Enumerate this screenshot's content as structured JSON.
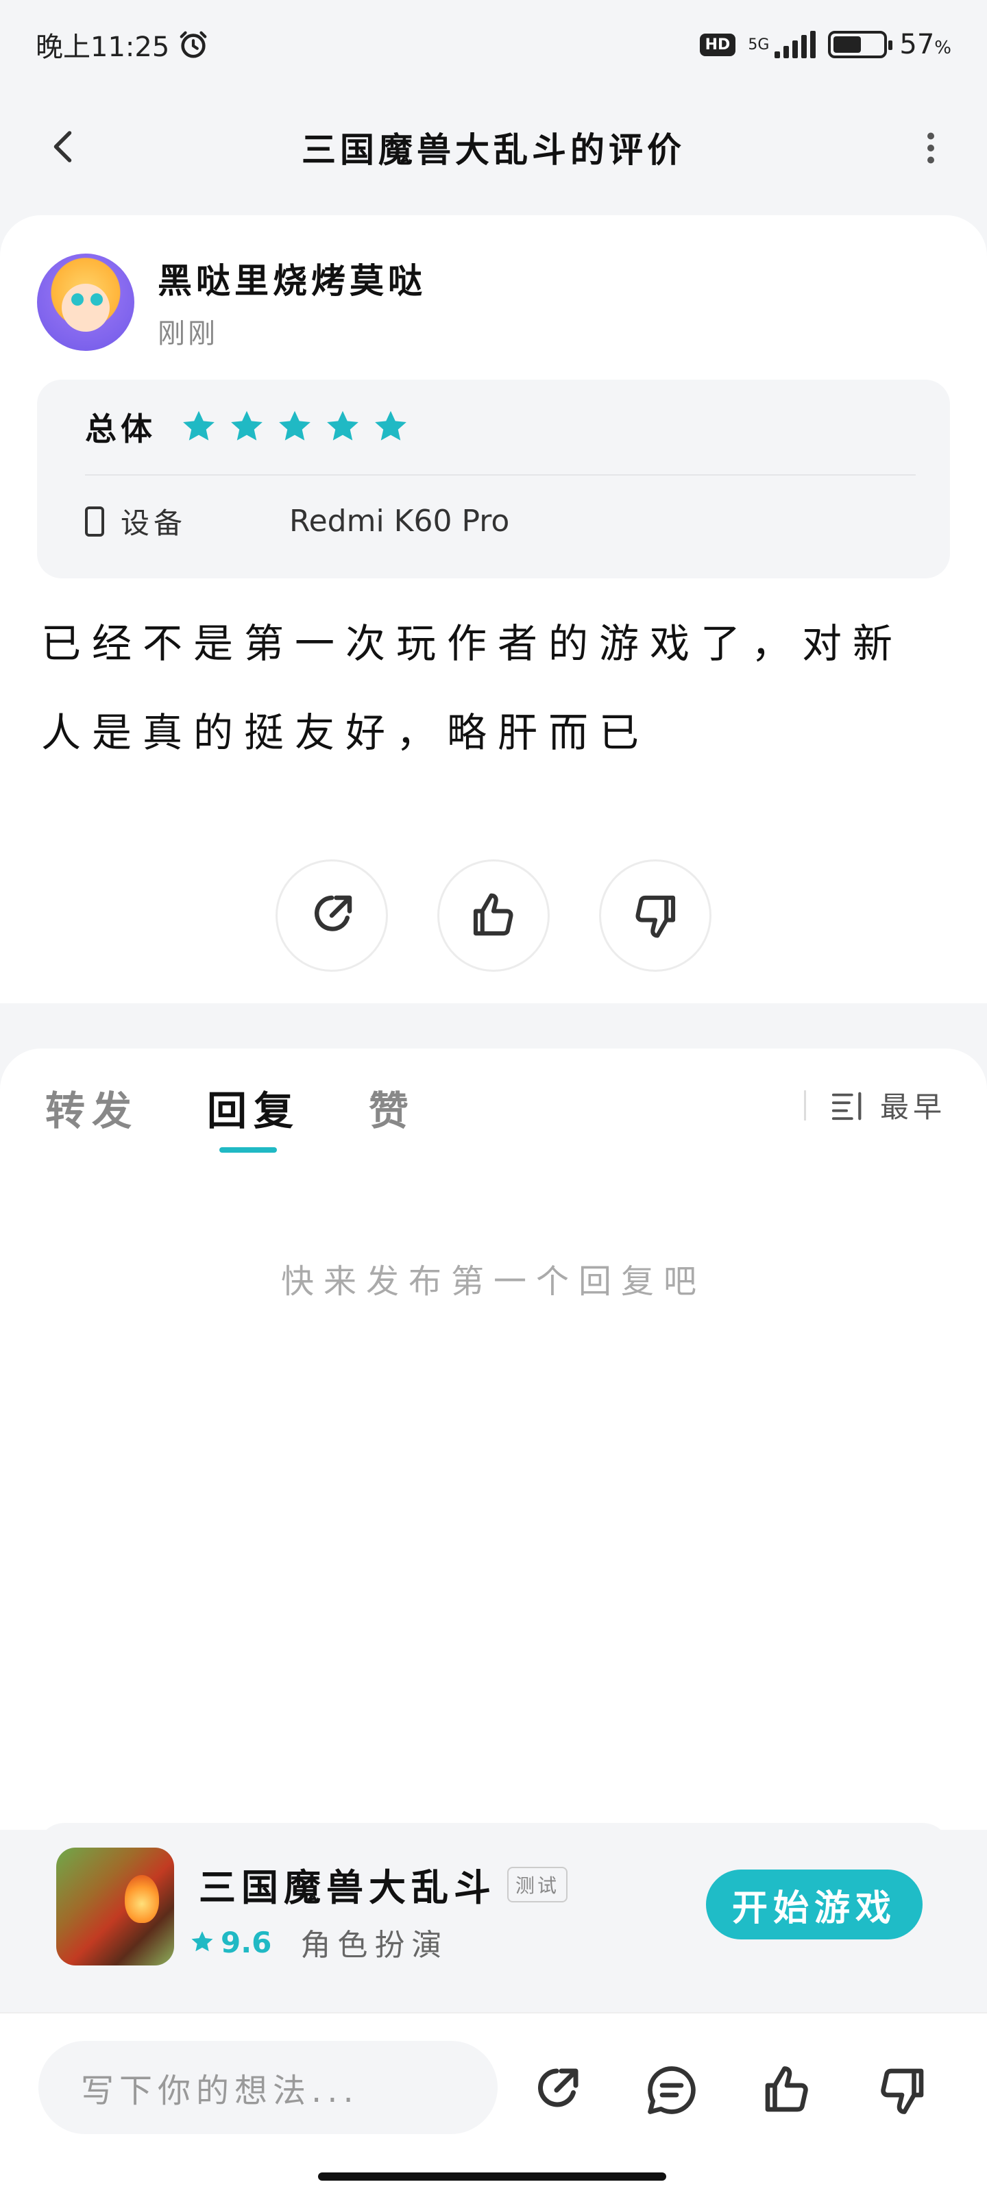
{
  "status_bar": {
    "time": "晚上11:25",
    "hd": "HD",
    "network": "5G",
    "battery_percent": "57",
    "battery_unit": "%",
    "battery_level": 0.57
  },
  "header": {
    "title": "三国魔兽大乱斗的评价"
  },
  "review": {
    "user_name": "黑哒里烧烤莫哒",
    "time": "刚刚",
    "overall_label": "总体",
    "stars": 5,
    "device_label": "设备",
    "device_value": "Redmi K60 Pro",
    "content": "已经不是第一次玩作者的游戏了，对新人是真的挺友好，略肝而已"
  },
  "tabs": [
    {
      "label": "转发",
      "active": false
    },
    {
      "label": "回复",
      "active": true
    },
    {
      "label": "赞",
      "active": false
    }
  ],
  "sort": {
    "label": "最早"
  },
  "empty_text": "快来发布第一个回复吧",
  "game": {
    "name": "三国魔兽大乱斗",
    "tag": "测试",
    "score": "9.6",
    "category": "角色扮演",
    "play_label": "开始游戏"
  },
  "bottom": {
    "input_placeholder": "写下你的想法..."
  },
  "colors": {
    "accent": "#1fbcc7",
    "star": "#20b9c4"
  }
}
